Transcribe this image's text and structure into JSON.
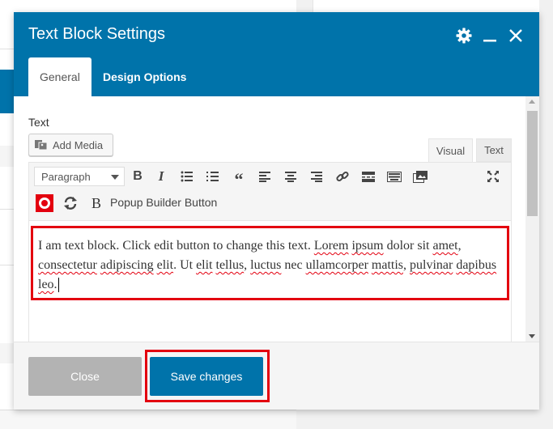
{
  "modal": {
    "title": "Text Block Settings",
    "tabs": [
      {
        "label": "General",
        "active": true
      },
      {
        "label": "Design Options",
        "active": false
      }
    ]
  },
  "editor": {
    "field_label": "Text",
    "add_media_label": "Add Media",
    "mode_tabs": [
      "Visual",
      "Text"
    ],
    "active_mode": "Visual",
    "format_select": "Paragraph",
    "toolbar_row1": [
      "bold-icon",
      "italic-icon",
      "bullet-list-icon",
      "numbered-list-icon",
      "blockquote-icon",
      "align-left-icon",
      "align-center-icon",
      "align-right-icon",
      "link-icon",
      "read-more-icon",
      "keyboard-icon",
      "gallery-icon",
      "fullscreen-icon"
    ],
    "toolbar_row2": [
      "popup-target-icon",
      "refresh-icon",
      "popup-builder-icon"
    ],
    "popup_button_label": "Popup Builder Button",
    "content_segments": [
      {
        "text": "I am text block. Click edit button to change this text. ",
        "spell": false
      },
      {
        "text": "Lorem",
        "spell": true
      },
      {
        "text": " ",
        "spell": false
      },
      {
        "text": "ipsum",
        "spell": true
      },
      {
        "text": " dolor sit ",
        "spell": false
      },
      {
        "text": "amet",
        "spell": true
      },
      {
        "text": ", ",
        "spell": false
      },
      {
        "text": "consectetur",
        "spell": true
      },
      {
        "text": " ",
        "spell": false
      },
      {
        "text": "adipiscing",
        "spell": true
      },
      {
        "text": " ",
        "spell": false
      },
      {
        "text": "elit",
        "spell": true
      },
      {
        "text": ". Ut ",
        "spell": false
      },
      {
        "text": "elit",
        "spell": true
      },
      {
        "text": " ",
        "spell": false
      },
      {
        "text": "tellus",
        "spell": true
      },
      {
        "text": ", ",
        "spell": false
      },
      {
        "text": "luctus",
        "spell": true
      },
      {
        "text": " nec ",
        "spell": false
      },
      {
        "text": "ullamcorper",
        "spell": true
      },
      {
        "text": " ",
        "spell": false
      },
      {
        "text": "mattis",
        "spell": true
      },
      {
        "text": ", ",
        "spell": false
      },
      {
        "text": "pulvinar",
        "spell": true
      },
      {
        "text": " ",
        "spell": false
      },
      {
        "text": "dapibus",
        "spell": true
      },
      {
        "text": " ",
        "spell": false
      },
      {
        "text": "leo",
        "spell": true
      },
      {
        "text": ".",
        "spell": false
      }
    ]
  },
  "footer": {
    "close_label": "Close",
    "save_label": "Save changes"
  },
  "colors": {
    "header_blue": "#0073aa",
    "highlight_red": "#e3000f",
    "close_gray": "#b3b3b3"
  }
}
